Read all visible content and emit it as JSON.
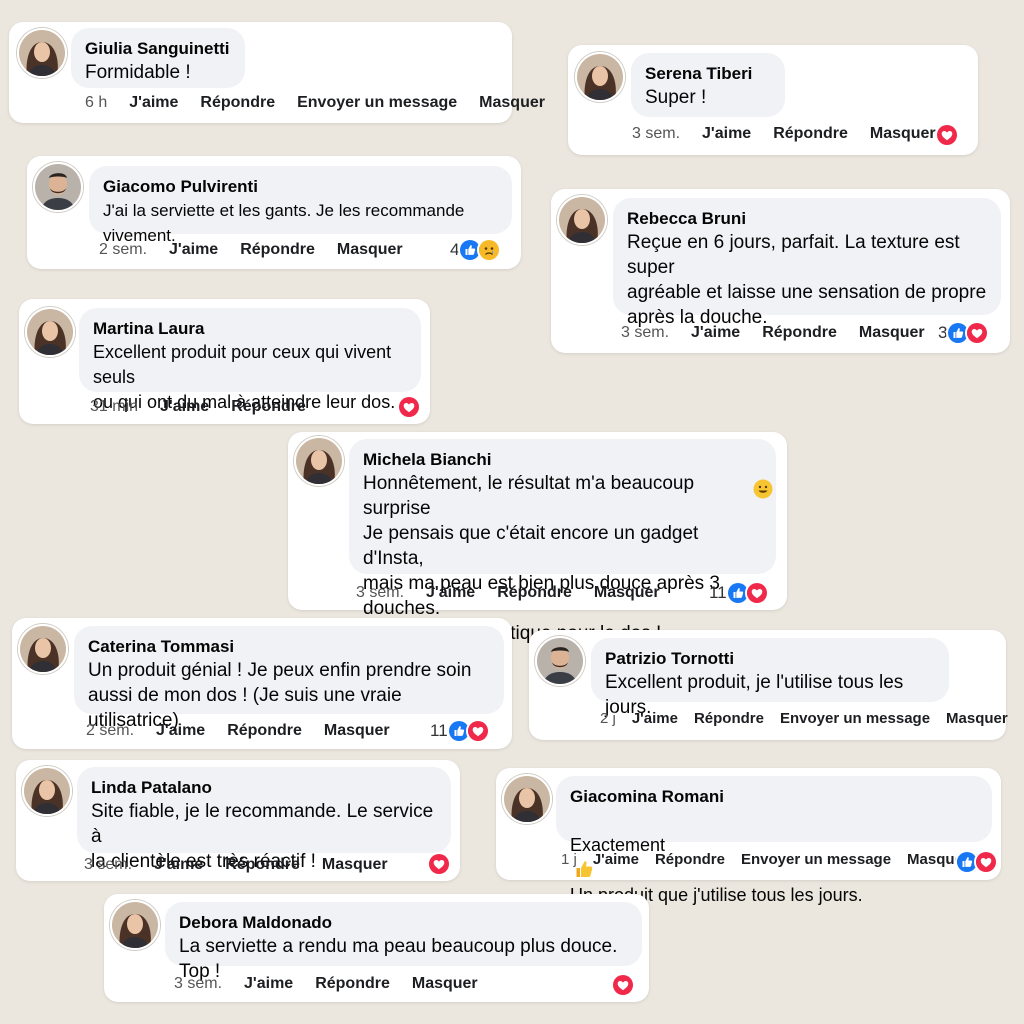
{
  "comments": [
    {
      "name": "Giulia Sanguinetti",
      "text": "Formidable !",
      "time": "6 h",
      "actions": [
        "J'aime",
        "Répondre",
        "Envoyer un message",
        "Masquer"
      ],
      "reactions": {
        "count": "",
        "types": []
      }
    },
    {
      "name": "Serena Tiberi",
      "text": "Super !",
      "time": "3 sem.",
      "actions": [
        "J'aime",
        "Répondre",
        "Masquer"
      ],
      "reactions": {
        "count": "",
        "types": [
          "love"
        ]
      }
    },
    {
      "name": "Giacomo Pulvirenti",
      "text": "J'ai la serviette et les gants. Je les recommande vivement.",
      "time": "2 sem.",
      "actions": [
        "J'aime",
        "Répondre",
        "Masquer"
      ],
      "reactions": {
        "count": "4",
        "types": [
          "like",
          "sad"
        ]
      }
    },
    {
      "name": "Rebecca Bruni",
      "text": "Reçue en 6 jours, parfait. La texture est super\nagréable et laisse une sensation de propre\naprès la douche.",
      "time": "3 sem.",
      "actions": [
        "J'aime",
        "Répondre",
        "Masquer"
      ],
      "reactions": {
        "count": "3",
        "types": [
          "like",
          "love"
        ]
      }
    },
    {
      "name": "Martina Laura",
      "text": "Excellent produit pour ceux qui vivent seuls\nou qui ont du mal à atteindre leur dos.",
      "time": "31 min",
      "actions": [
        "J'aime",
        "Répondre"
      ],
      "reactions": {
        "count": "",
        "types": [
          "love"
        ]
      }
    },
    {
      "name": "Michela Bianchi",
      "text": "Honnêtement, le résultat m'a beaucoup surprise\nJe pensais que c'était encore un gadget d'Insta,\nmais ma peau est bien plus douce après 3 douches.\nEt c'est super pratique pour le dos !",
      "time": "3 sem.",
      "actions": [
        "J'aime",
        "Répondre",
        "Masquer"
      ],
      "reactions": {
        "count": "11",
        "types": [
          "like",
          "love"
        ]
      }
    },
    {
      "name": "Caterina Tommasi",
      "text": "Un produit génial ! Je peux enfin prendre soin\naussi de mon dos ! (Je suis une vraie utilisatrice)",
      "time": "2 sem.",
      "actions": [
        "J'aime",
        "Répondre",
        "Masquer"
      ],
      "reactions": {
        "count": "11",
        "types": [
          "like",
          "love"
        ]
      }
    },
    {
      "name": "Patrizio Tornotti",
      "text": "Excellent produit, je l'utilise tous les jours.",
      "time": "2 j",
      "actions": [
        "J'aime",
        "Répondre",
        "Envoyer un message",
        "Masquer"
      ],
      "reactions": {
        "count": "",
        "types": []
      }
    },
    {
      "name": "Linda Patalano",
      "text": "Site fiable, je le recommande. Le service à\nla clientèle est très réactif !",
      "time": "3 sem.",
      "actions": [
        "J'aime",
        "Répondre",
        "Masquer"
      ],
      "reactions": {
        "count": "",
        "types": [
          "love"
        ]
      }
    },
    {
      "name": "Giacomina Romani",
      "text_before": "Exactement",
      "text_after": "Un produit que j'utilise tous les jours.",
      "time": "1 j",
      "actions": [
        "J'aime",
        "Répondre",
        "Envoyer un message",
        "Masquer"
      ],
      "reactions": {
        "count": "",
        "types": [
          "like",
          "love"
        ]
      }
    },
    {
      "name": "Debora Maldonado",
      "text": "La serviette a rendu ma peau beaucoup plus douce. Top !",
      "time": "3 sem.",
      "actions": [
        "J'aime",
        "Répondre",
        "Masquer"
      ],
      "reactions": {
        "count": "",
        "types": [
          "love"
        ]
      }
    }
  ],
  "colors": {
    "like": "#1877f2",
    "love": "#f02849",
    "sad": "#f7b928",
    "background": "#ebe7df",
    "bubble": "#f0f2f5"
  },
  "icons": {
    "like": "thumbs-up-icon",
    "love": "heart-icon",
    "sad": "crying-face-icon",
    "smile": "smiling-face-icon",
    "thumbs": "thumbs-up-emoji-icon"
  }
}
